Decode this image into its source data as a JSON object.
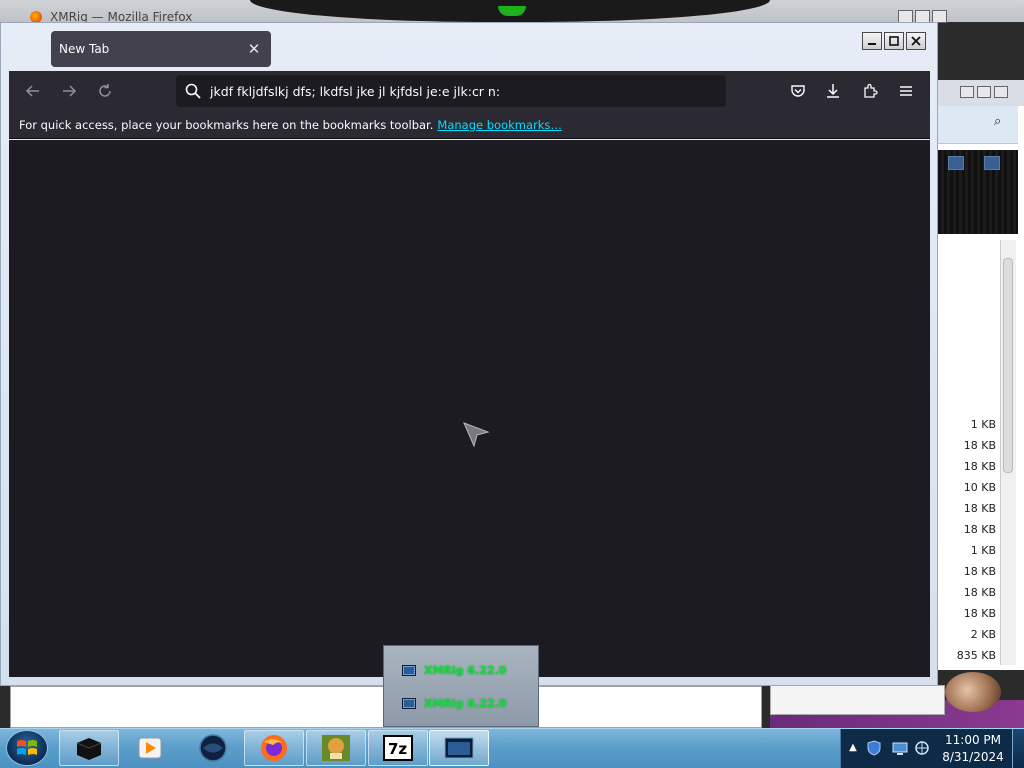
{
  "background_window": {
    "title": "XMRig — Mozilla Firefox"
  },
  "firefox": {
    "tab": {
      "label": "New Tab"
    },
    "urlbar": {
      "value": "jkdf fkljdfslkj dfs; lkdfsl jke jl kjfdsl je:e jlk:cr n:"
    },
    "bookmarks_bar": {
      "message": "For quick access, place your bookmarks here on the bookmarks toolbar.",
      "link": "Manage bookmarks…"
    },
    "icons": {
      "back": "back-arrow-icon",
      "forward": "forward-arrow-icon",
      "reload": "reload-icon",
      "search": "search-icon",
      "pocket": "pocket-icon",
      "downloads": "download-icon",
      "extensions": "extensions-icon",
      "menu": "hamburger-menu-icon"
    }
  },
  "file_list": {
    "sizes": [
      "1 KB",
      "18 KB",
      "18 KB",
      "10 KB",
      "18 KB",
      "18 KB",
      "1 KB",
      "18 KB",
      "18 KB",
      "18 KB",
      "2 KB",
      "835 KB"
    ]
  },
  "taskbar_popup": {
    "items": [
      "XMRig 6.22.0",
      "XMRig 6.22.0"
    ]
  },
  "taskbar": {
    "clock": {
      "time": "11:00 PM",
      "date": "8/31/2024"
    }
  },
  "colors": {
    "toolbar_bg": "#2b2a33",
    "content_bg": "#1c1b22",
    "link": "#00ddff",
    "taskbar": "#5c9fcb",
    "popup_text": "#1fd641"
  }
}
